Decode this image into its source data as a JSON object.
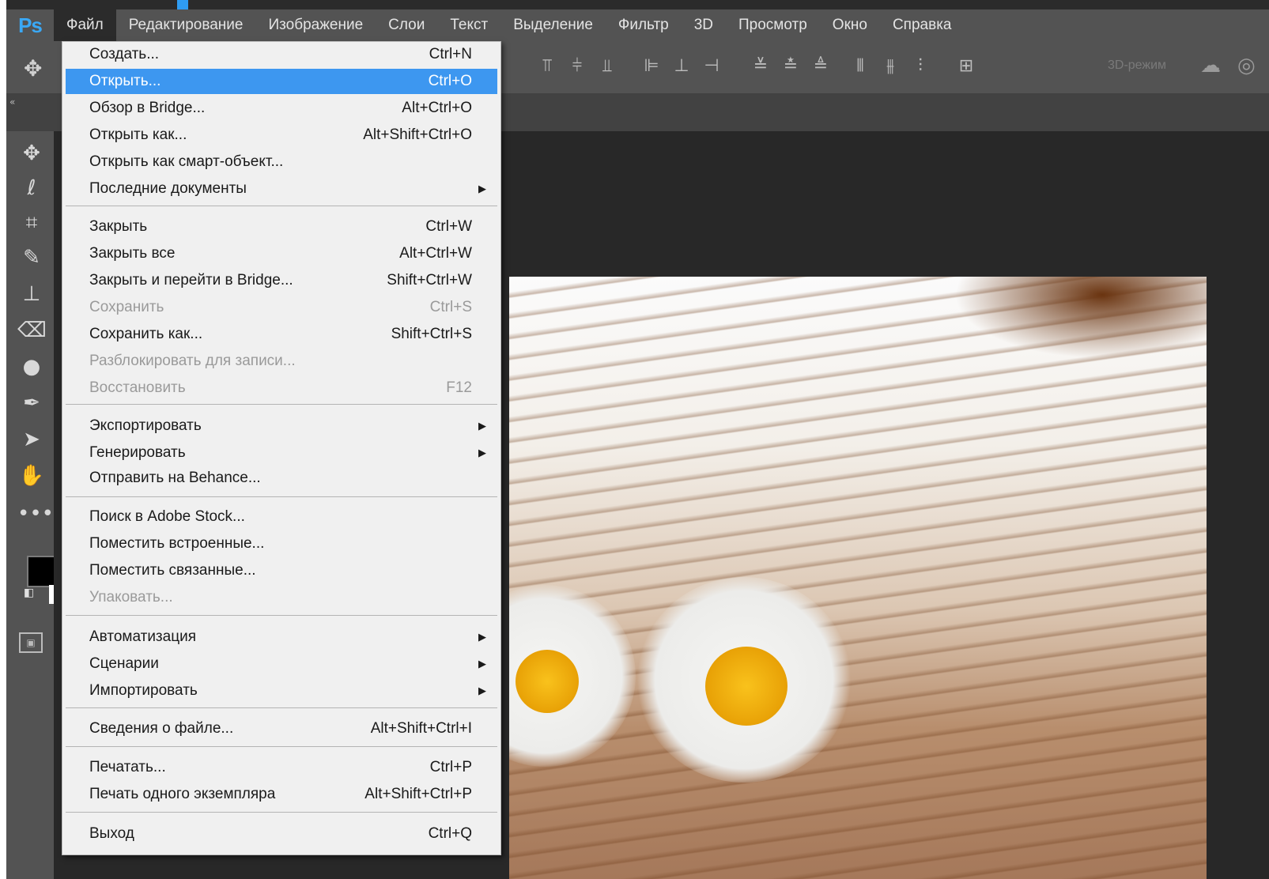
{
  "menubar": {
    "logo": "Ps",
    "items": [
      "Файл",
      "Редактирование",
      "Изображение",
      "Слои",
      "Текст",
      "Выделение",
      "Фильтр",
      "3D",
      "Просмотр",
      "Окно",
      "Справка"
    ]
  },
  "options": {
    "mode_3d": "3D-режим"
  },
  "file_menu": {
    "items": [
      {
        "label": "Создать...",
        "shortcut": "Ctrl+N"
      },
      {
        "label": "Открыть...",
        "shortcut": "Ctrl+O",
        "highlighted": true
      },
      {
        "label": "Обзор в Bridge...",
        "shortcut": "Alt+Ctrl+O"
      },
      {
        "label": "Открыть как...",
        "shortcut": "Alt+Shift+Ctrl+O"
      },
      {
        "label": "Открыть как смарт-объект...",
        "shortcut": ""
      },
      {
        "label": "Последние документы",
        "shortcut": "",
        "submenu": true
      },
      {
        "label": "Закрыть",
        "shortcut": "Ctrl+W"
      },
      {
        "label": "Закрыть все",
        "shortcut": "Alt+Ctrl+W"
      },
      {
        "label": "Закрыть и перейти в Bridge...",
        "shortcut": "Shift+Ctrl+W"
      },
      {
        "label": "Сохранить",
        "shortcut": "Ctrl+S",
        "disabled": true
      },
      {
        "label": "Сохранить как...",
        "shortcut": "Shift+Ctrl+S"
      },
      {
        "label": "Разблокировать для записи...",
        "shortcut": "",
        "disabled": true
      },
      {
        "label": "Восстановить",
        "shortcut": "F12",
        "disabled": true
      },
      {
        "label": "Экспортировать",
        "shortcut": "",
        "submenu": true
      },
      {
        "label": "Генерировать",
        "shortcut": "",
        "submenu": true
      },
      {
        "label": "Отправить на Behance...",
        "shortcut": ""
      },
      {
        "label": "Поиск в Adobe Stock...",
        "shortcut": ""
      },
      {
        "label": "Поместить встроенные...",
        "shortcut": ""
      },
      {
        "label": "Поместить связанные...",
        "shortcut": ""
      },
      {
        "label": "Упаковать...",
        "shortcut": "",
        "disabled": true
      },
      {
        "label": "Автоматизация",
        "shortcut": "",
        "submenu": true
      },
      {
        "label": "Сценарии",
        "shortcut": "",
        "submenu": true
      },
      {
        "label": "Импортировать",
        "shortcut": "",
        "submenu": true
      },
      {
        "label": "Сведения о файле...",
        "shortcut": "Alt+Shift+Ctrl+I"
      },
      {
        "label": "Печатать...",
        "shortcut": "Ctrl+P"
      },
      {
        "label": "Печать одного экземпляра",
        "shortcut": "Alt+Shift+Ctrl+P"
      },
      {
        "label": "Выход",
        "shortcut": "Ctrl+Q"
      }
    ]
  },
  "toolbar": {
    "tools": [
      "move-tool-icon",
      "lasso-tool-icon",
      "crop-tool-icon",
      "healing-brush-icon",
      "stamp-tool-icon",
      "eraser-tool-icon",
      "blur-tool-icon",
      "pen-tool-icon",
      "path-selection-icon",
      "hand-tool-icon",
      "more-tools-icon"
    ]
  },
  "colors": {
    "accent": "#3d97f0",
    "logo": "#3aa8f5",
    "menubar": "#535353"
  }
}
